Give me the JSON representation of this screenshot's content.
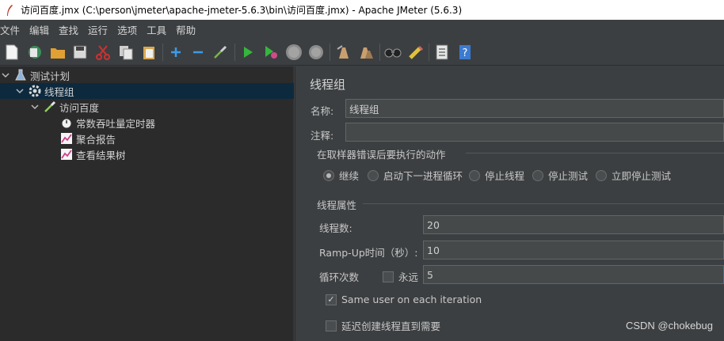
{
  "window": {
    "title": "访问百度.jmx (C:\\person\\jmeter\\apache-jmeter-5.6.3\\bin\\访问百度.jmx) - Apache JMeter (5.6.3)"
  },
  "menu": [
    "文件",
    "编辑",
    "查找",
    "运行",
    "选项",
    "工具",
    "帮助"
  ],
  "toolbar": [
    "new-icon",
    "templates-icon",
    "open-icon",
    "save-icon",
    "cut-icon",
    "copy-icon",
    "paste-icon",
    "expand-icon",
    "collapse-icon",
    "toggle-icon",
    "start-icon",
    "start-no-pauses-icon",
    "stop-icon",
    "shutdown-icon",
    "clear-icon",
    "clear-all-icon",
    "search-icon",
    "reset-search-icon",
    "function-helper-icon",
    "help-icon"
  ],
  "tree": {
    "test_plan": "测试计划",
    "thread_group": "线程组",
    "sampler": "访问百度",
    "timer": "常数吞吐量定时器",
    "aggregate_report": "聚合报告",
    "results_tree": "查看结果树"
  },
  "panel": {
    "title": "线程组",
    "name_label": "名称:",
    "name_value": "线程组",
    "comment_label": "注释:",
    "comment_value": "",
    "error_action_title": "在取样器错误后要执行的动作",
    "error_actions": [
      "继续",
      "启动下一进程循环",
      "停止线程",
      "停止测试",
      "立即停止测试"
    ],
    "thread_props_title": "线程属性",
    "threads_label": "线程数:",
    "threads_value": "20",
    "rampup_label": "Ramp-Up时间（秒）:",
    "rampup_value": "10",
    "loop_label": "循环次数",
    "forever_label": "永远",
    "loop_value": "5",
    "same_user_label": "Same user on each iteration",
    "delay_label": "延迟创建线程直到需要"
  },
  "watermark": "CSDN @chokebug"
}
